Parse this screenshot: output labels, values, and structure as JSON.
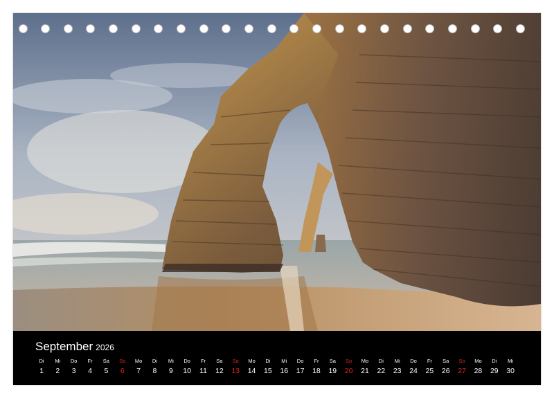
{
  "calendar": {
    "month": "September",
    "year": "2026",
    "sunday_color": "#e0261c",
    "days": [
      {
        "name": "Di",
        "date": "1"
      },
      {
        "name": "Mi",
        "date": "2"
      },
      {
        "name": "Do",
        "date": "3"
      },
      {
        "name": "Fr",
        "date": "4"
      },
      {
        "name": "Sa",
        "date": "5"
      },
      {
        "name": "So",
        "date": "6",
        "sunday": true
      },
      {
        "name": "Mo",
        "date": "7"
      },
      {
        "name": "Di",
        "date": "8"
      },
      {
        "name": "Mi",
        "date": "9"
      },
      {
        "name": "Do",
        "date": "10"
      },
      {
        "name": "Fr",
        "date": "11"
      },
      {
        "name": "Sa",
        "date": "12"
      },
      {
        "name": "So",
        "date": "13",
        "sunday": true
      },
      {
        "name": "Mo",
        "date": "14"
      },
      {
        "name": "Di",
        "date": "15"
      },
      {
        "name": "Mi",
        "date": "16"
      },
      {
        "name": "Do",
        "date": "17"
      },
      {
        "name": "Fr",
        "date": "18"
      },
      {
        "name": "Sa",
        "date": "19"
      },
      {
        "name": "So",
        "date": "20",
        "sunday": true
      },
      {
        "name": "Mo",
        "date": "21"
      },
      {
        "name": "Di",
        "date": "22"
      },
      {
        "name": "Mi",
        "date": "23"
      },
      {
        "name": "Do",
        "date": "24"
      },
      {
        "name": "Fr",
        "date": "25"
      },
      {
        "name": "Sa",
        "date": "26"
      },
      {
        "name": "So",
        "date": "27",
        "sunday": true
      },
      {
        "name": "Mo",
        "date": "28"
      },
      {
        "name": "Di",
        "date": "29"
      },
      {
        "name": "Mi",
        "date": "30"
      }
    ]
  },
  "binding": {
    "hole_count": 23
  }
}
